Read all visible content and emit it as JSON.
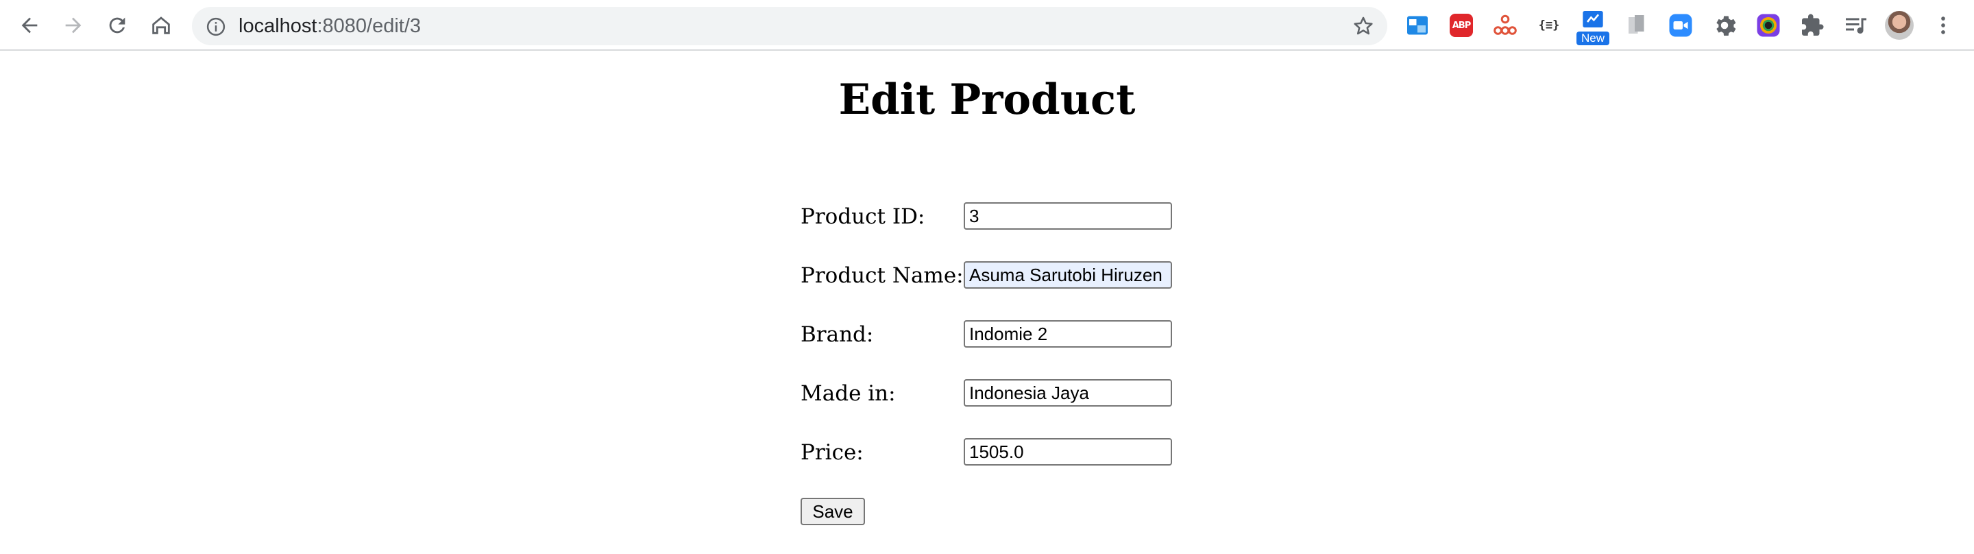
{
  "browser": {
    "url_host": "localhost",
    "url_path": ":8080/edit/3",
    "extensions": [
      {
        "name": "screen-capture-extension-icon"
      },
      {
        "name": "adblock-plus-icon",
        "label": "ABP"
      },
      {
        "name": "org-chart-extension-icon"
      },
      {
        "name": "json-viewer-icon",
        "label": "{≡}"
      },
      {
        "name": "new-extension-icon",
        "badge": "New"
      },
      {
        "name": "extension-icon"
      },
      {
        "name": "zoom-icon"
      },
      {
        "name": "settings-gear-extension-icon"
      },
      {
        "name": "color-picker-icon"
      },
      {
        "name": "extensions-puzzle-icon"
      },
      {
        "name": "reading-list-icon"
      }
    ],
    "colors": {
      "accent": "#1a73e8",
      "omnibox": "#f1f3f4"
    }
  },
  "page": {
    "title": "Edit Product",
    "fields": [
      {
        "label": "Product ID:",
        "value": "3"
      },
      {
        "label": "Product Name:",
        "value": "Asuma Sarutobi Hiruzen"
      },
      {
        "label": "Brand:",
        "value": "Indomie 2"
      },
      {
        "label": "Made in:",
        "value": "Indonesia Jaya"
      },
      {
        "label": "Price:",
        "value": "1505.0"
      }
    ],
    "save_label": "Save"
  }
}
